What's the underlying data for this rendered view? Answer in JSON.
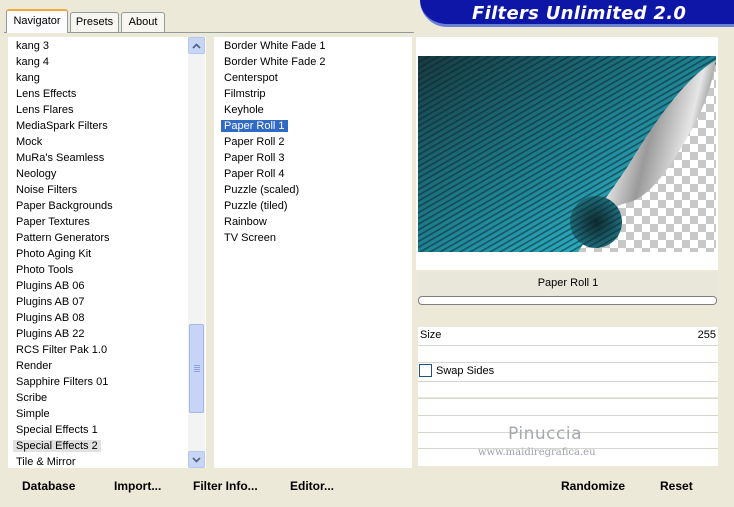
{
  "app": {
    "title": "Filters Unlimited 2.0"
  },
  "tabs": [
    {
      "label": "Navigator",
      "active": true
    },
    {
      "label": "Presets",
      "active": false
    },
    {
      "label": "About",
      "active": false
    }
  ],
  "categories": {
    "items": [
      "kang 3",
      "kang 4",
      "kang",
      "Lens Effects",
      "Lens Flares",
      "MediaSpark Filters",
      "Mock",
      "MuRa's Seamless",
      "Neology",
      "Noise Filters",
      "Paper Backgrounds",
      "Paper Textures",
      "Pattern Generators",
      "Photo Aging Kit",
      "Photo Tools",
      "Plugins AB 06",
      "Plugins AB 07",
      "Plugins AB 08",
      "Plugins AB 22",
      "RCS Filter Pak 1.0",
      "Render",
      "Sapphire Filters 01",
      "Scribe",
      "Simple",
      "Special Effects 1",
      "Special Effects 2",
      "Tile & Mirror"
    ],
    "selected": "Special Effects 2"
  },
  "filters": {
    "items": [
      "Border White Fade 1",
      "Border White Fade 2",
      "Centerspot",
      "Filmstrip",
      "Keyhole",
      "Paper Roll 1",
      "Paper Roll 2",
      "Paper Roll 3",
      "Paper Roll 4",
      "Puzzle (scaled)",
      "Puzzle (tiled)",
      "Rainbow",
      "TV Screen"
    ],
    "selected": "Paper Roll 1"
  },
  "filter_panel": {
    "name": "Paper Roll 1",
    "progress": 0,
    "size_label": "Size",
    "size_value": "255",
    "swap_label": "Swap Sides",
    "swap_checked": false
  },
  "buttons": {
    "database": "Database",
    "import": "Import...",
    "filter_info": "Filter Info...",
    "editor": "Editor...",
    "randomize": "Randomize",
    "reset": "Reset"
  },
  "watermark": {
    "line1": "Pinuccia",
    "line2": "www.maidiregrafica.eu"
  },
  "colors": {
    "banner": "#0e16a8",
    "selection": "#316ac5",
    "dialog_bg": "#ece9d8",
    "preview_teal": "#2aa8bc"
  }
}
